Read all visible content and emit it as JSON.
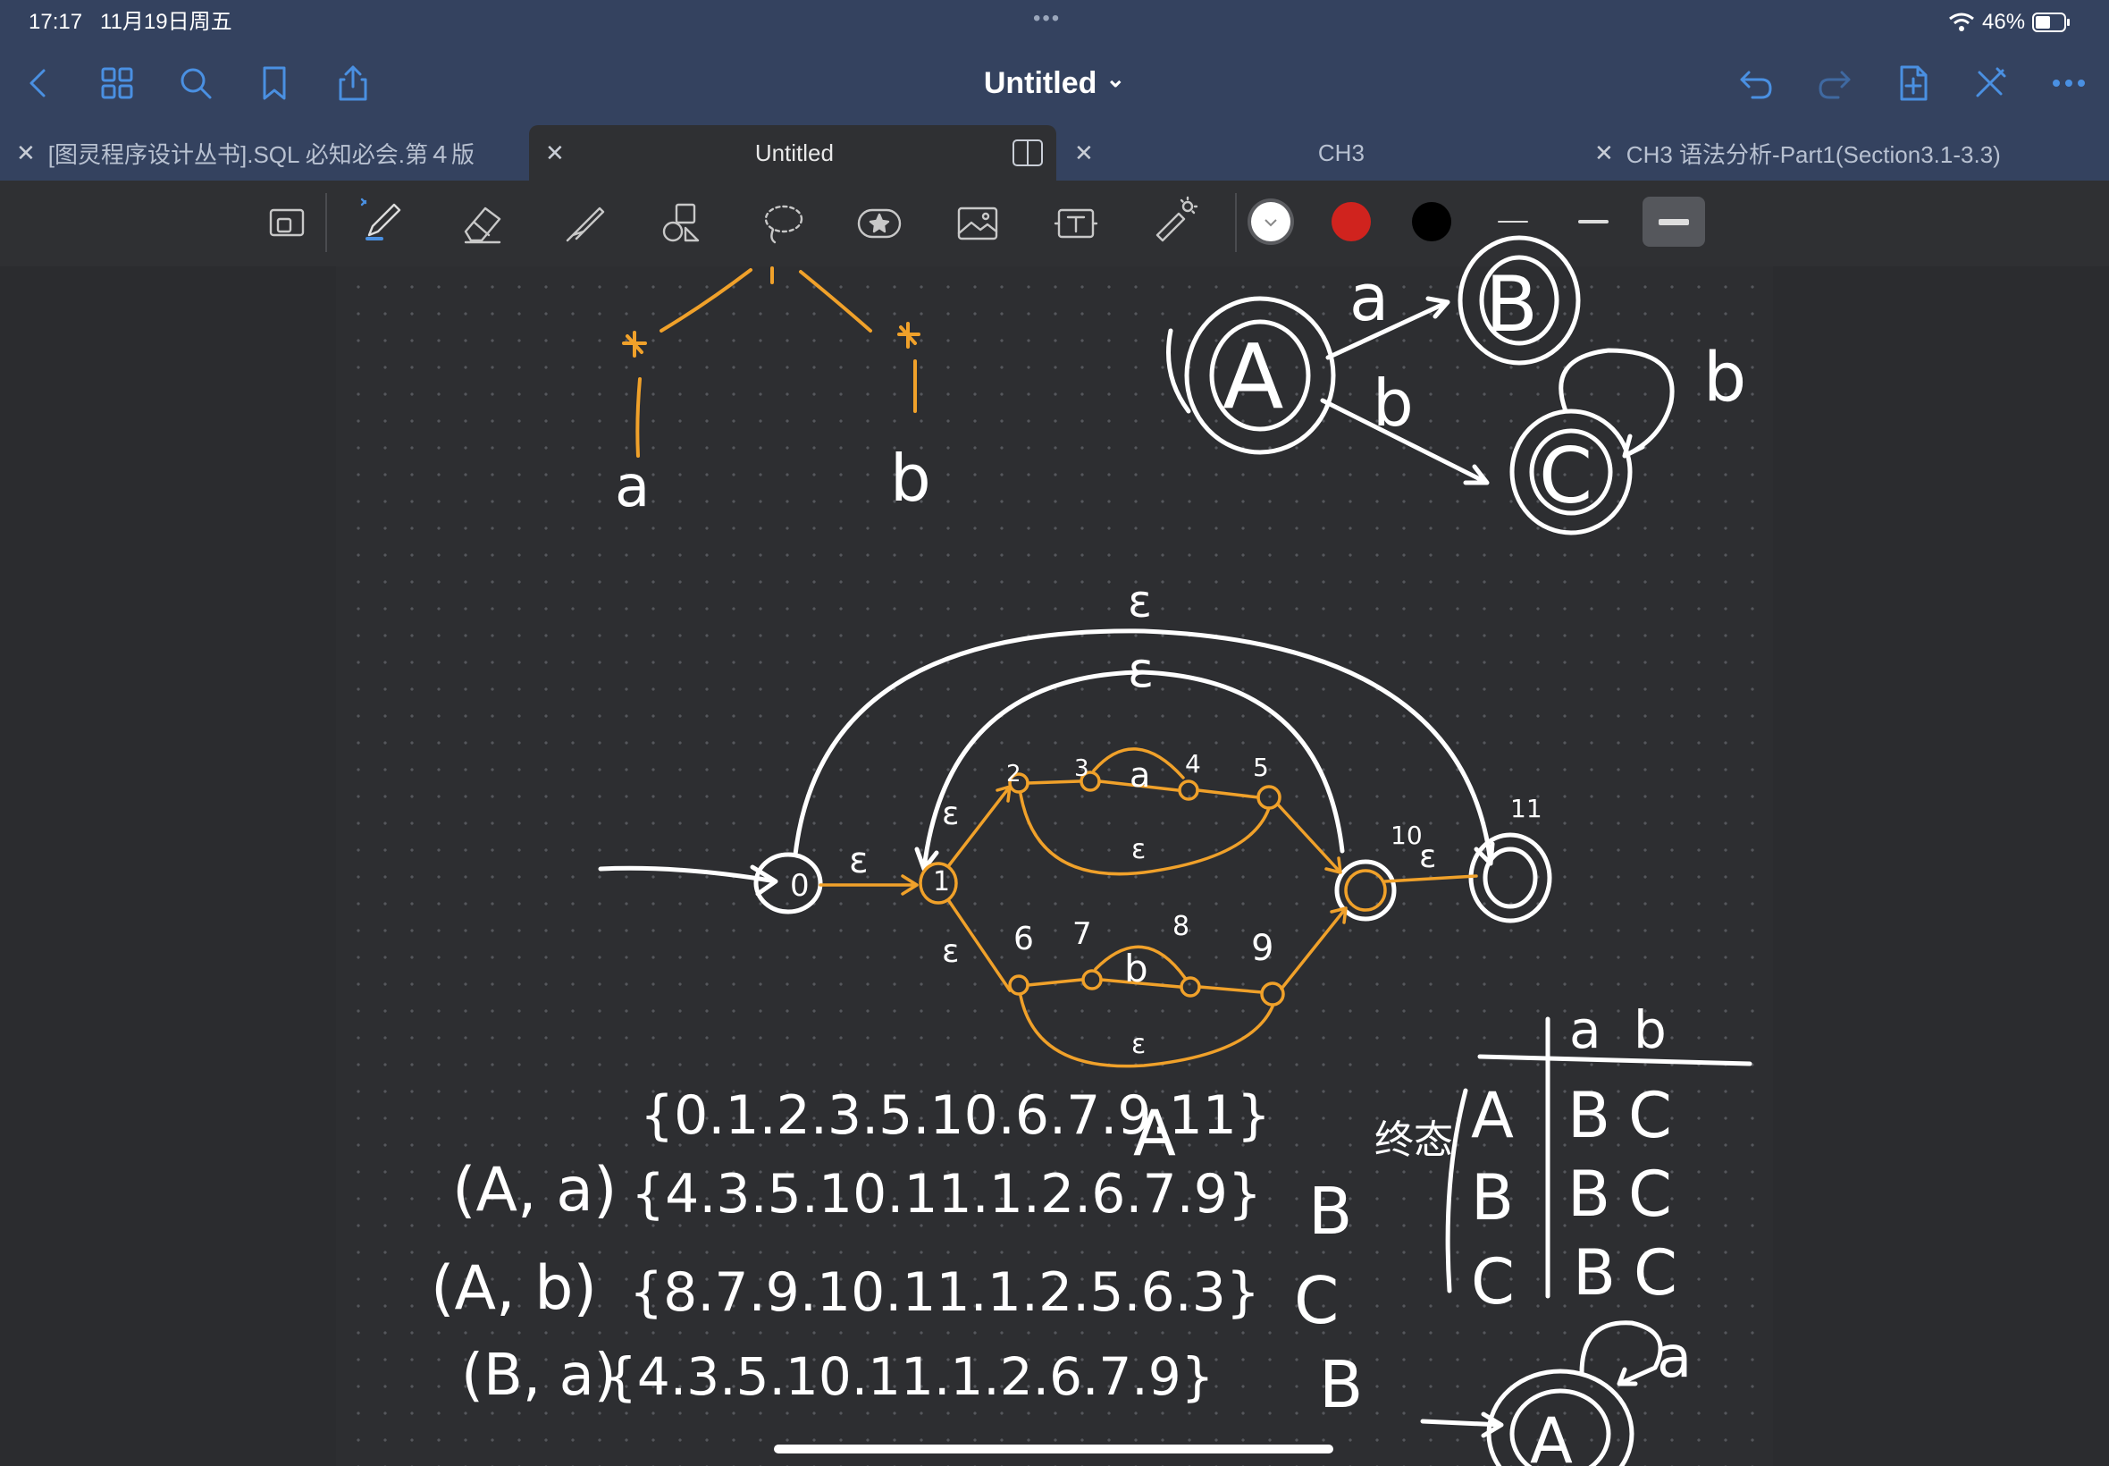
{
  "status_bar": {
    "time": "17:17",
    "date": "11月19日周五",
    "battery": "46%",
    "dots": "•••"
  },
  "nav": {
    "doc_title": "Untitled",
    "doc_title_chevron": "⌄"
  },
  "tabs": [
    {
      "label": "[图灵程序设计丛书].SQL 必知必会.第４版",
      "active": false
    },
    {
      "label": "Untitled",
      "active": true
    },
    {
      "label": "CH3",
      "active": false
    },
    {
      "label": "CH3 语法分析-Part1(Section3.1-3.3)",
      "active": false
    }
  ],
  "toolbar": {
    "tools": [
      "zoom-window-icon",
      "pen-icon",
      "eraser-icon",
      "highlighter-icon",
      "shapes-icon",
      "lasso-icon",
      "sticker-icon",
      "image-icon",
      "text-icon",
      "laser-pointer-icon"
    ],
    "colors": [
      "#ffffff",
      "#d0231e",
      "#000000"
    ],
    "stroke_widths": [
      "thin",
      "medium",
      "thick"
    ],
    "selected_stroke": "thick"
  },
  "notes": {
    "top_left_tree": {
      "labels": [
        "a",
        "b"
      ]
    },
    "dfa_top_right": {
      "states": [
        "A",
        "B",
        "C"
      ],
      "edges": [
        "a",
        "b",
        "b"
      ]
    },
    "nfa": {
      "epsilon": "ε",
      "state_numbers": [
        "0",
        "1",
        "2",
        "3",
        "4",
        "5",
        "6",
        "7",
        "8",
        "9",
        "10",
        "11"
      ],
      "symbols": [
        "a",
        "b"
      ]
    },
    "subset_rows": [
      {
        "left": "",
        "set": "{0.1.2.3.5.10.6.7.9.11}",
        "name": "A"
      },
      {
        "left": "(A, a)",
        "set": "{4.3.5.10.11.1.2.6.7.9}",
        "name": "B"
      },
      {
        "left": "(A, b)",
        "set": "{8.7.9.10.11.1.2.5.6.3}",
        "name": "C"
      },
      {
        "left": "(B, a)",
        "set": "{4.3.5.10.11.1.2.6.7.9}",
        "name": "B"
      }
    ],
    "transition_table": {
      "headers": [
        "a",
        "b"
      ],
      "rows": [
        {
          "state": "A",
          "a": "B",
          "b": "C"
        },
        {
          "state": "B",
          "a": "B",
          "b": "C"
        },
        {
          "state": "C",
          "a": "B",
          "b": "C"
        }
      ],
      "side_label": "终态"
    },
    "min_dfa": {
      "state": "A",
      "loop": "a"
    }
  }
}
